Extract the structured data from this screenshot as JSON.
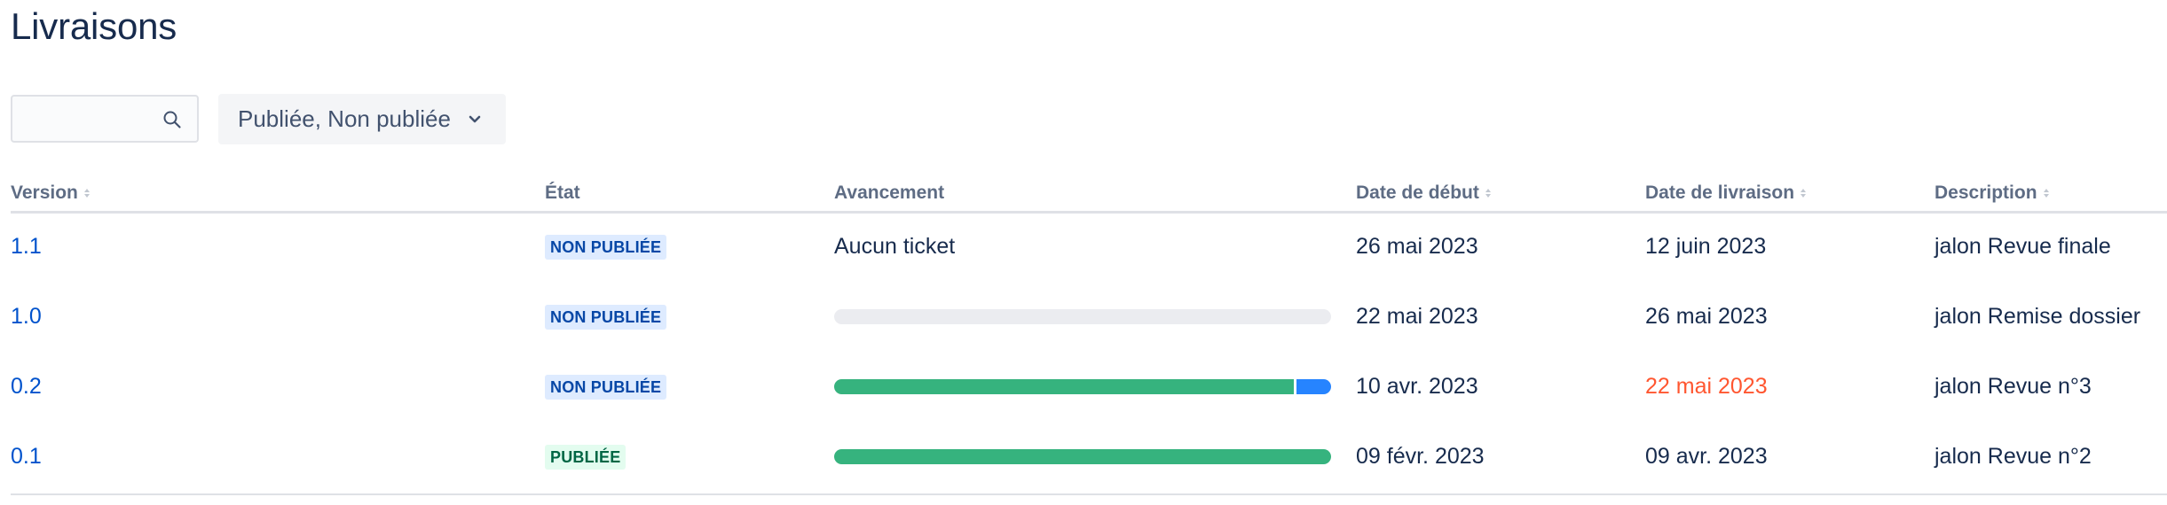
{
  "page": {
    "title": "Livraisons"
  },
  "search": {
    "value": "",
    "placeholder": ""
  },
  "filter": {
    "label": "Publiée, Non publiée"
  },
  "table": {
    "headers": {
      "version": "Version",
      "status": "État",
      "progress": "Avancement",
      "start_date": "Date de début",
      "release_date": "Date de livraison",
      "description": "Description"
    },
    "rows": [
      {
        "version": "1.1",
        "status": "NON PUBLIÉE",
        "status_type": "unreleased",
        "progress_text": "Aucun ticket",
        "progress": null,
        "start_date": "26 mai 2023",
        "release_date": "12 juin 2023",
        "release_overdue": false,
        "description": "jalon Revue finale"
      },
      {
        "version": "1.0",
        "status": "NON PUBLIÉE",
        "status_type": "unreleased",
        "progress_text": "",
        "progress": {
          "done": 0,
          "in_progress": 0
        },
        "start_date": "22 mai 2023",
        "release_date": "26 mai 2023",
        "release_overdue": false,
        "description": "jalon Remise dossier"
      },
      {
        "version": "0.2",
        "status": "NON PUBLIÉE",
        "status_type": "unreleased",
        "progress_text": "",
        "progress": {
          "done": 0.93,
          "in_progress": 0.07
        },
        "start_date": "10 avr. 2023",
        "release_date": "22 mai 2023",
        "release_overdue": true,
        "description": "jalon Revue n°3"
      },
      {
        "version": "0.1",
        "status": "PUBLIÉE",
        "status_type": "released",
        "progress_text": "",
        "progress": {
          "done": 1,
          "in_progress": 0
        },
        "start_date": "09 févr. 2023",
        "release_date": "09 avr. 2023",
        "release_overdue": false,
        "description": "jalon Revue n°2"
      }
    ]
  },
  "colors": {
    "link": "#0052cc",
    "done": "#36b37e",
    "in_progress": "#2684ff",
    "todo": "#ebecf0",
    "overdue": "#ff5630"
  }
}
